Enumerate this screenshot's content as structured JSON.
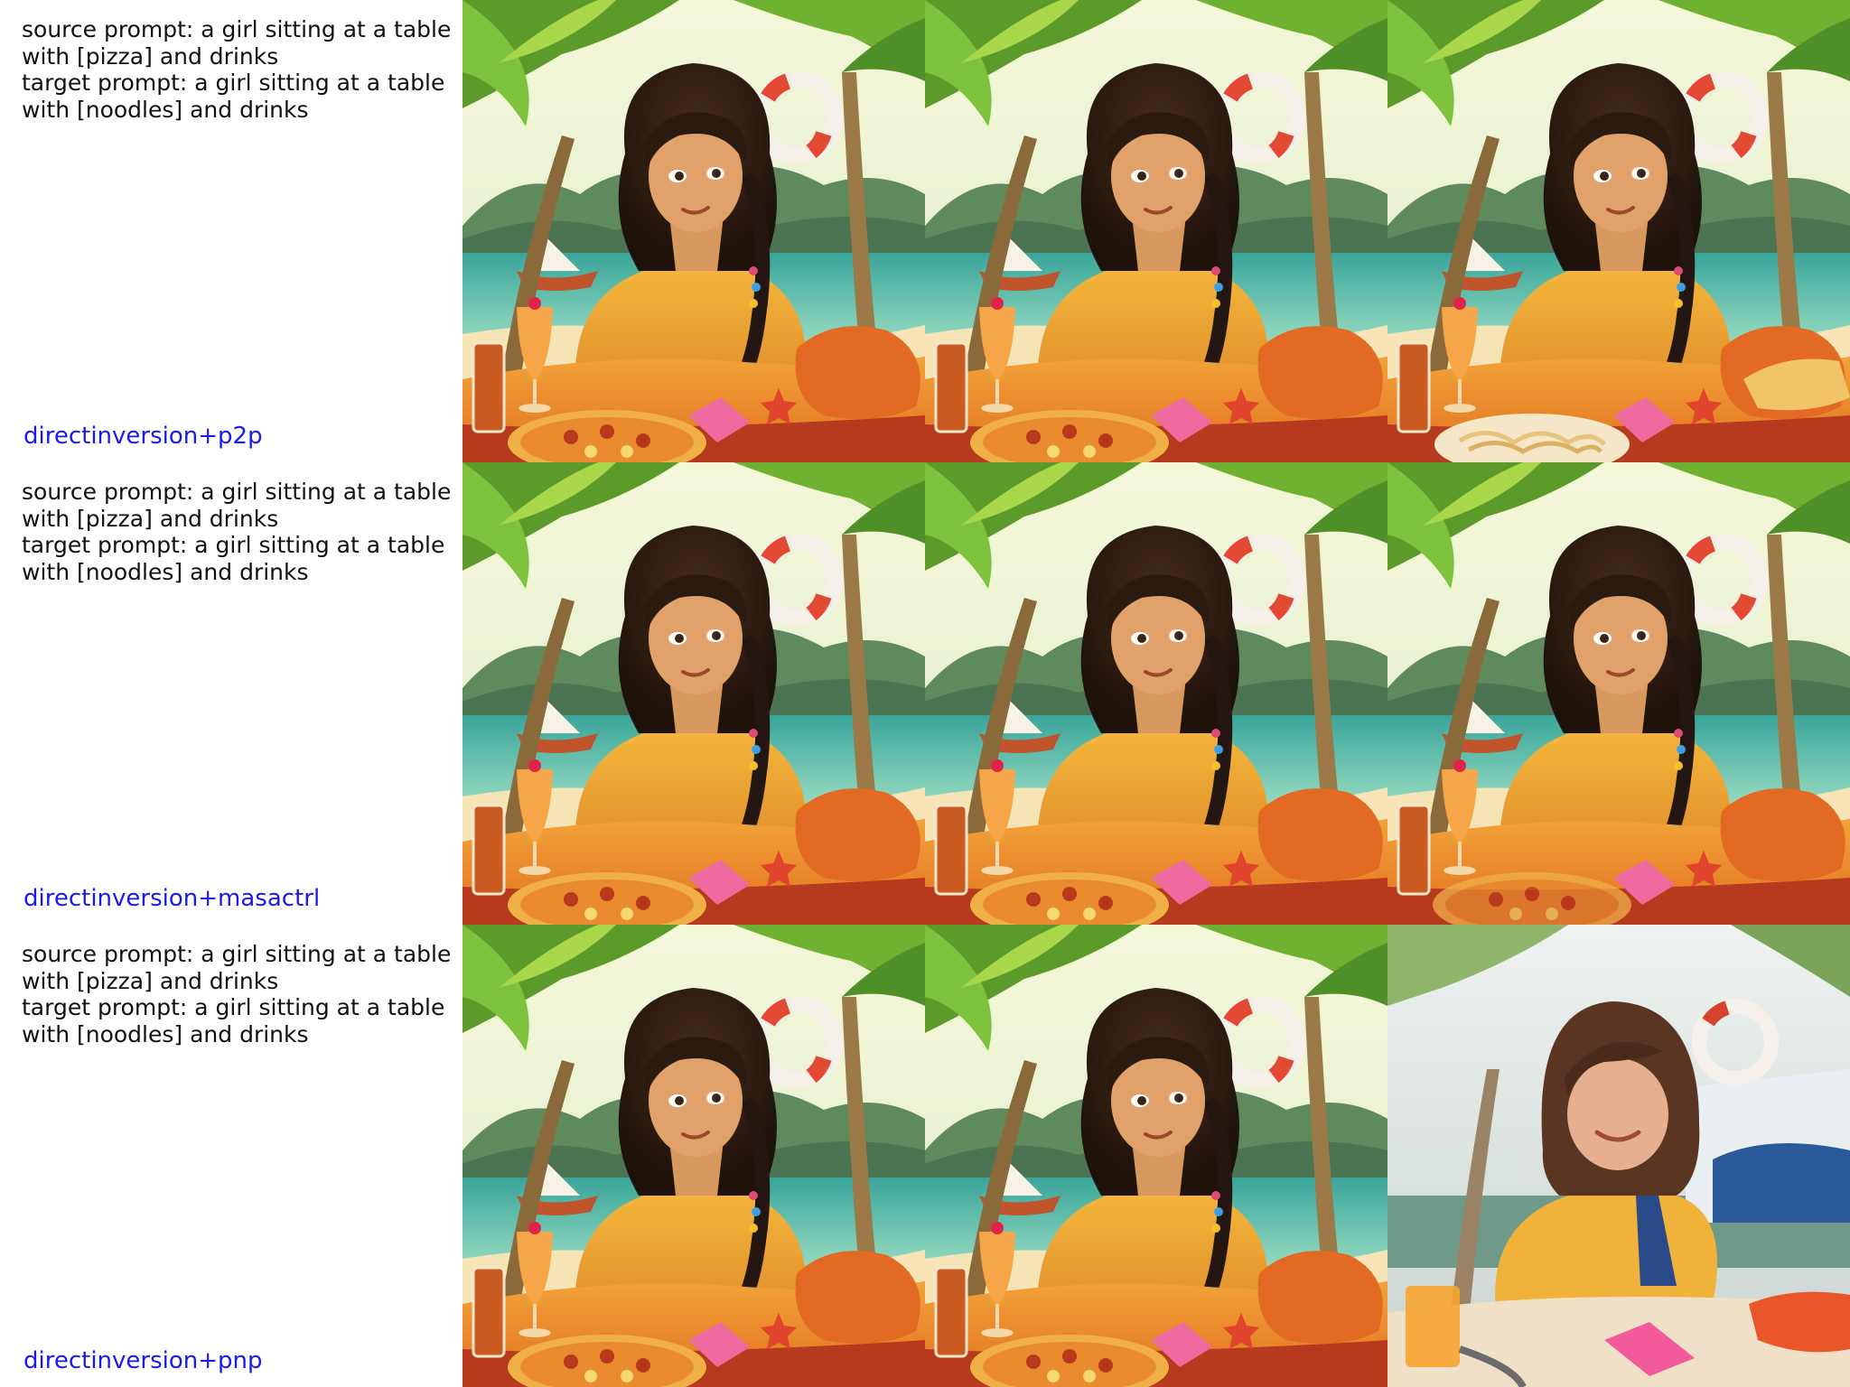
{
  "rows": [
    {
      "source_prompt": "source prompt: a girl sitting at a table with [pizza] and drinks",
      "target_prompt": "target prompt: a girl sitting at a table with [noodles] and drinks",
      "method": "directinversion+p2p"
    },
    {
      "source_prompt": "source prompt: a girl sitting at a table with [pizza] and drinks",
      "target_prompt": "target prompt: a girl sitting at a table with [noodles] and drinks",
      "method": "directinversion+masactrl"
    },
    {
      "source_prompt": "source prompt: a girl sitting at a table with [pizza] and drinks",
      "target_prompt": "target prompt: a girl sitting at a table with [noodles] and drinks",
      "method": "directinversion+pnp"
    }
  ],
  "colors": {
    "method_label": "#1a1aee",
    "prompt_text": "#111111",
    "background": "#ffffff"
  }
}
